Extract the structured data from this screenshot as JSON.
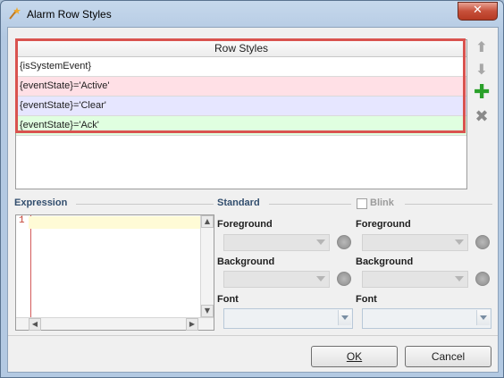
{
  "window": {
    "title": "Alarm Row Styles",
    "close_glyph": "✕"
  },
  "row_styles": {
    "header": "Row Styles",
    "rows": [
      {
        "expression": "{isSystemEvent}",
        "color": "#ffffff"
      },
      {
        "expression": "{eventState}='Active'",
        "color": "#ffe0e6"
      },
      {
        "expression": "{eventState}='Clear'",
        "color": "#e6e6ff"
      },
      {
        "expression": "{eventState}='Ack'",
        "color": "#e0ffe0"
      }
    ],
    "highlight_color": "#d9534f"
  },
  "side_buttons": {
    "move_up_icon": "arrow-up-icon",
    "move_down_icon": "arrow-down-icon",
    "add_icon": "plus-icon",
    "remove_icon": "x-icon"
  },
  "expression": {
    "label": "Expression",
    "line_number": "1",
    "value": ""
  },
  "standard": {
    "label": "Standard",
    "blink_label": "Blink",
    "blink_checked": false,
    "foreground_label": "Foreground",
    "background_label": "Background",
    "font_label": "Font"
  },
  "buttons": {
    "ok": "OK",
    "cancel": "Cancel"
  }
}
